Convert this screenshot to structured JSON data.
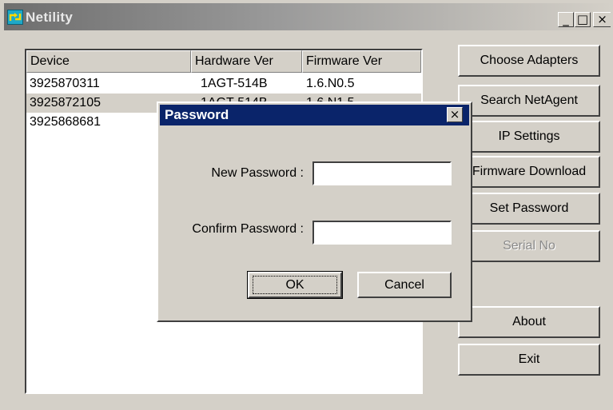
{
  "window": {
    "title": "Netility",
    "minimize_glyph": "_",
    "maximize_glyph": "□",
    "close_glyph": "×",
    "icon": "netility-app-icon"
  },
  "device_list": {
    "columns": [
      "Device",
      "Hardware Ver",
      "Firmware Ver"
    ],
    "rows": [
      {
        "device": "3925870311",
        "hardware": "1AGT-514B",
        "firmware": "1.6.N0.5",
        "selected": false
      },
      {
        "device": "3925872105",
        "hardware": "1AGT-514B",
        "firmware": "1.6.N1.5",
        "selected": true
      },
      {
        "device": "3925868681",
        "hardware": "",
        "firmware": "",
        "selected": false
      }
    ]
  },
  "buttons": {
    "choose_adapters": "Choose Adapters",
    "search_netagent": "Search NetAgent",
    "ip_settings": "IP Settings",
    "firmware_download": "Firmware Download",
    "set_password": "Set Password",
    "serial_no": "Serial No",
    "about": "About",
    "exit": "Exit"
  },
  "password_dialog": {
    "title": "Password",
    "close_glyph": "×",
    "new_password_label": "New Password :",
    "new_password_value": "",
    "confirm_password_label": "Confirm Password :",
    "confirm_password_value": "",
    "ok": "OK",
    "cancel": "Cancel"
  },
  "colors": {
    "dialog_title_bar": "#0a246a",
    "window_face": "#d4d0c8",
    "inactive_title_gradient": "#6e6e6e"
  }
}
